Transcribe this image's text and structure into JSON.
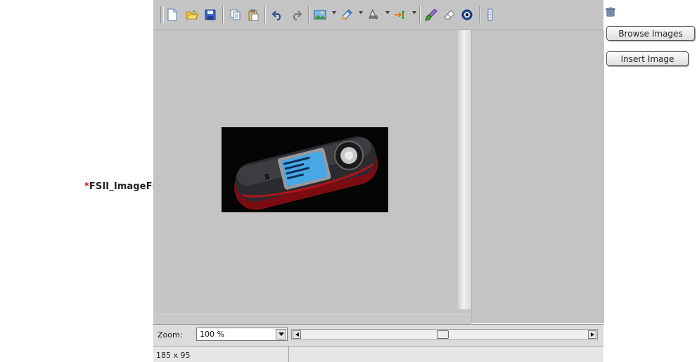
{
  "form": {
    "required_marker": "*",
    "field_label": "FSII_ImageFile:"
  },
  "toolbar": {
    "buttons": [
      {
        "name": "new-document-icon"
      },
      {
        "name": "open-folder-icon"
      },
      {
        "name": "save-icon"
      },
      {
        "name": "copy-icon"
      },
      {
        "name": "paste-icon"
      },
      {
        "name": "undo-icon"
      },
      {
        "name": "redo-icon"
      },
      {
        "name": "insert-image-icon",
        "dropdown": true
      },
      {
        "name": "color-picker-icon",
        "dropdown": true
      },
      {
        "name": "fill-bucket-icon",
        "dropdown": true
      },
      {
        "name": "resize-arrows-icon",
        "dropdown": true
      },
      {
        "name": "brush-icon"
      },
      {
        "name": "eraser-icon"
      },
      {
        "name": "red-eye-icon"
      },
      {
        "name": "more-options-icon"
      }
    ]
  },
  "side_buttons": {
    "browse_label": "Browse Images",
    "insert_label": "Insert Image",
    "delete_icon": "trash-icon"
  },
  "statusbar": {
    "zoom_label": "Zoom:",
    "zoom_value": "100 %",
    "image_dimensions": "185 x 95"
  },
  "colors": {
    "canvas_background": "#c4c4c4",
    "required_marker": "#dd0000"
  }
}
